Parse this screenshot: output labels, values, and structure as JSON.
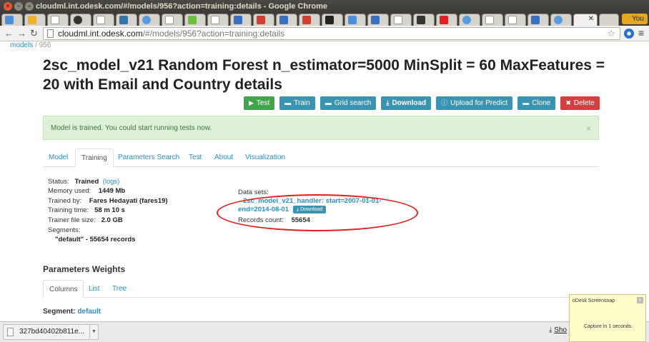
{
  "window": {
    "title": "cloudml.int.odesk.com/#/models/956?action=training:details - Google Chrome",
    "close": "×",
    "min": "–",
    "max": "+"
  },
  "tabs": {
    "user_button": "You"
  },
  "address": {
    "host": "cloudml.int.odesk.com",
    "path": "/#/models/956?action=training:details",
    "back": "←",
    "forward": "→",
    "reload": "↻",
    "bookmark": "☆",
    "menu": "≡"
  },
  "breadcrumb": {
    "models": "models",
    "sep": "/",
    "id": "956"
  },
  "model": {
    "title": "2sc_model_v21 Random Forest n_estimator=5000 MinSplit = 60 MaxFeatures = 20 with Email and Country details"
  },
  "actions": {
    "test": "Test",
    "train": "Train",
    "grid_search": "Grid search",
    "download": "Download",
    "upload": "Upload for Predict",
    "clone": "Clone",
    "delete": "Delete"
  },
  "alert": {
    "text": "Model is trained. You could start running tests now.",
    "close": "×"
  },
  "nav_tabs": [
    "Model",
    "Training",
    "Parameters Search",
    "Test",
    "About",
    "Visualization"
  ],
  "training": {
    "status_label": "Status:",
    "status_value": "Trained",
    "logs": "(logs)",
    "memory_label": "Memory used:",
    "memory_value": "1449 Mb",
    "trained_by_label": "Trained by:",
    "trained_by_value": "Fares Hedayati (fares19)",
    "time_label": "Training time:",
    "time_value": "58 m 10 s",
    "size_label": "Trainer file size:",
    "size_value": "2.0 GB",
    "segments_label": "Segments:",
    "segments_value": "\"default\" - 55654 records"
  },
  "datasets": {
    "label": "Data sets:",
    "link_line1": "2sc_model_v21_handler: start=2007-01-01-",
    "link_line2": "end=2014-08-01",
    "download": "Download",
    "records_label": "Records count:",
    "records_value": "55654"
  },
  "weights": {
    "heading": "Parameters Weights",
    "tabs": [
      "Columns",
      "List",
      "Tree"
    ],
    "segment_label": "Segment:",
    "segment_value": "default"
  },
  "download_shelf": {
    "file": "327bd40402b811e...",
    "show_all": "Sho"
  },
  "screensnap": {
    "title": "oDesk Screensnap",
    "message": "Capture in 1 seconds.",
    "close": "x"
  },
  "colors": {
    "link": "#2a8fc5",
    "success": "#43a54b",
    "info": "#3a93b0",
    "danger": "#d33f3f",
    "annotation": "#e02020"
  }
}
